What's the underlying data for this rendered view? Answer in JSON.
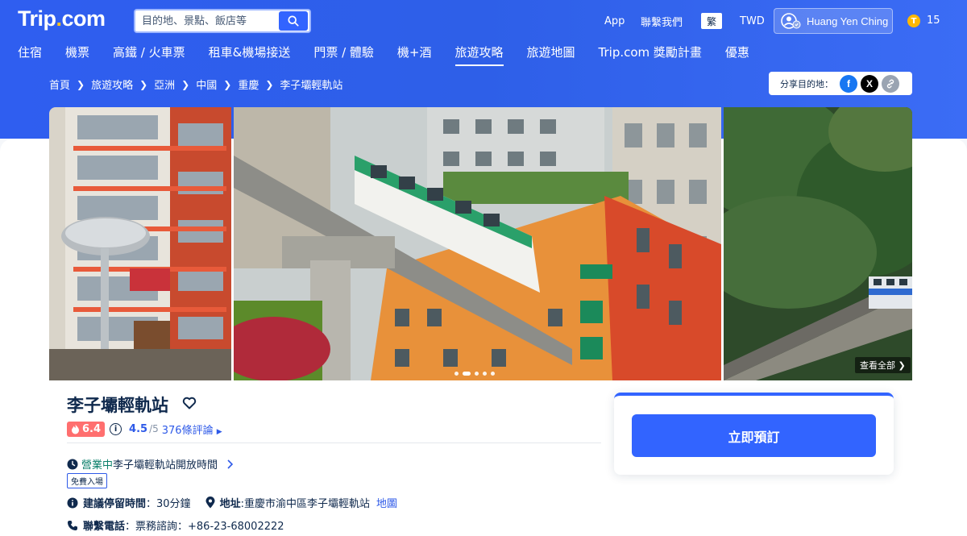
{
  "header": {
    "logo_main": "Trip",
    "logo_dot": ".",
    "logo_tld": "com",
    "search_placeholder": "目的地、景點、飯店等",
    "app_label": "App",
    "contact_label": "聯繫我們",
    "language_label": "繁",
    "currency_label": "TWD",
    "user_name": "Huang Yen Ching",
    "coin_symbol": "T",
    "coin_count": "15"
  },
  "nav": {
    "items": [
      {
        "label": "住宿"
      },
      {
        "label": "機票"
      },
      {
        "label": "高鐵 / 火車票"
      },
      {
        "label": "租車&機場接送"
      },
      {
        "label": "門票 / 體驗"
      },
      {
        "label": "機+酒"
      },
      {
        "label": "旅遊攻略",
        "active": true
      },
      {
        "label": "旅遊地圖"
      },
      {
        "label": "Trip.com 獎勵計畫"
      },
      {
        "label": "優惠"
      }
    ]
  },
  "breadcrumb": {
    "items": [
      "首頁",
      "旅遊攻略",
      "亞洲",
      "中國",
      "重慶",
      "李子壩輕軌站"
    ]
  },
  "share": {
    "label": "分享目的地：",
    "facebook_glyph": "f",
    "x_glyph": "X"
  },
  "gallery": {
    "view_all": "查看全部",
    "photo_count": 5,
    "current_photo": 2
  },
  "attraction": {
    "title": "李子壩輕軌站",
    "heat_score": "6.4",
    "info_glyph": "i",
    "rating": "4.5",
    "rating_total": "/5",
    "reviews": "376條評論",
    "open_status": "營業中",
    "hours_label": "李子壩輕軌站開放時間",
    "free_tag": "免費入場",
    "stay_label": "建議停留時間",
    "stay_value": "：30分鐘",
    "address_label": "地址",
    "address_value": ":重慶市渝中區李子壩輕軌站",
    "map_link": "地圖",
    "phone_label": "聯繫電話",
    "phone_value": "：票務諮詢：+86-23-68002222"
  },
  "booking": {
    "button_label": "立即預訂"
  },
  "colors": {
    "brand_blue": "#3264ff",
    "hero_blue": "#2f5ef0",
    "logo_yellow": "#ffc41b",
    "heat_red": "#ff6f6f",
    "open_green": "#0a7f6a",
    "link_blue": "#2e5ae8"
  }
}
